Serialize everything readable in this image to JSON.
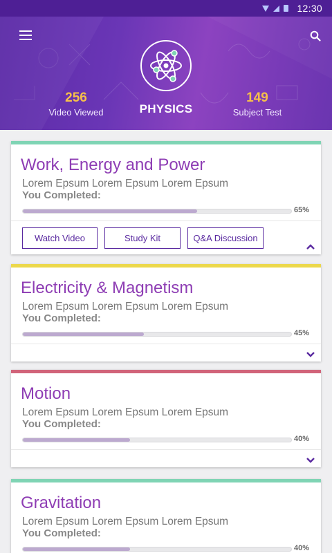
{
  "status_bar": {
    "time": "12:30"
  },
  "header": {
    "subject": "PHYSICS",
    "stats": [
      {
        "value": "256",
        "label": "Video Viewed"
      },
      {
        "value": "149",
        "label": "Subject Test"
      }
    ]
  },
  "cards": [
    {
      "title": "Work, Energy and Power",
      "description": "Lorem Epsum Lorem Epsum Lorem Epsum",
      "completed_label": "You Completed:",
      "progress_text": "65%",
      "progress": 0.65,
      "accent": "#7fd4b4",
      "expanded": true,
      "actions": [
        "Watch Video",
        "Study Kit",
        "Q&A Discussion"
      ]
    },
    {
      "title": "Electricity & Magnetism",
      "description": "Lorem Epsum Lorem Epsum Lorem Epsum",
      "completed_label": "You Completed:",
      "progress_text": "45%",
      "progress": 0.45,
      "accent": "#ecd84b",
      "expanded": false
    },
    {
      "title": "Motion",
      "description": "Lorem Epsum Lorem Epsum Lorem Epsum",
      "completed_label": "You Completed:",
      "progress_text": "40%",
      "progress": 0.4,
      "accent": "#d1647a",
      "expanded": false
    },
    {
      "title": "Gravitation",
      "description": "Lorem Epsum Lorem Epsum Lorem Epsum",
      "completed_label": "You Completed:",
      "progress_text": "40%",
      "progress": 0.4,
      "accent": "#7fd4b4",
      "expanded": false
    }
  ],
  "colors": {
    "header_primary": "#6a36b6",
    "status_bar": "#4e1f95",
    "title_purple": "#8e3db4",
    "stat_number": "#f6c04a",
    "button_border": "#5a2aa0"
  },
  "icons": {
    "menu": "menu-icon",
    "search": "search-icon",
    "logo": "atom-icon",
    "expand": "chevron-up-icon",
    "collapse": "chevron-down-icon"
  }
}
